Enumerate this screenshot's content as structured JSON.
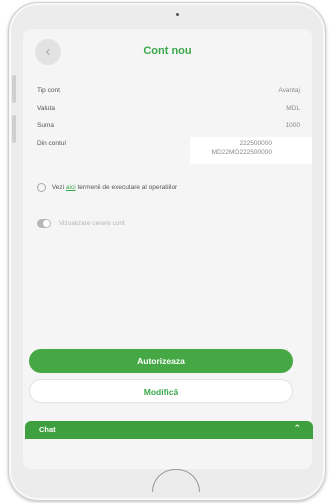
{
  "header": {
    "back_icon": "chevron-left-icon",
    "title": "Cont nou"
  },
  "details": [
    {
      "label": "Tip cont",
      "value": "Avantaj"
    },
    {
      "label": "Valuta",
      "value": "MDL"
    },
    {
      "label": "Suma",
      "value": "1000"
    }
  ],
  "source_account": {
    "label": "Din contul",
    "line1": "222500000",
    "line2": "MD22MO222500000"
  },
  "terms": {
    "icon": "info-icon",
    "prefix": "Vezi",
    "link": "aici",
    "suffix": "termenii de executare al operatiilor"
  },
  "preview_toggle": {
    "label": "Vizualizare cerere cont",
    "checked": true
  },
  "buttons": {
    "authorize": "Autorizeaza",
    "modify": "Modifică"
  },
  "chat": {
    "label": "Chat",
    "chevron": "⌃"
  },
  "colors": {
    "accent": "#45a845",
    "title": "#3aa84a"
  }
}
